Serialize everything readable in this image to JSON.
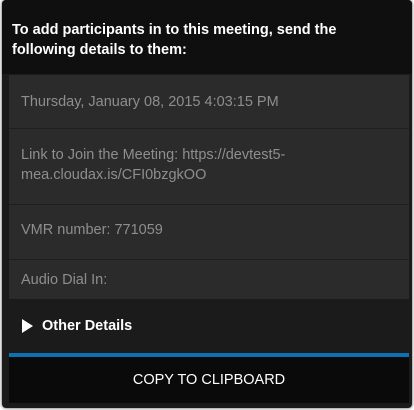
{
  "header": {
    "message": "To add participants in to this meeting, send the following details to them:"
  },
  "details": {
    "date": "Thursday, January 08, 2015 4:03:15 PM",
    "link": "Link to Join the Meeting: https://devtest5-mea.cloudax.is/CFI0bzgkOO",
    "vmr": "VMR number: 771059",
    "audio": "Audio Dial In:"
  },
  "other_details": {
    "label": "Other Details",
    "icon": "expand-triangle-icon"
  },
  "copy_button": {
    "label": "COPY TO CLIPBOARD"
  },
  "colors": {
    "accent": "#0e6fb3",
    "panel_background": "#1b1b1b",
    "details_background": "#2b2b2b",
    "detail_text": "#8e8e8e"
  }
}
